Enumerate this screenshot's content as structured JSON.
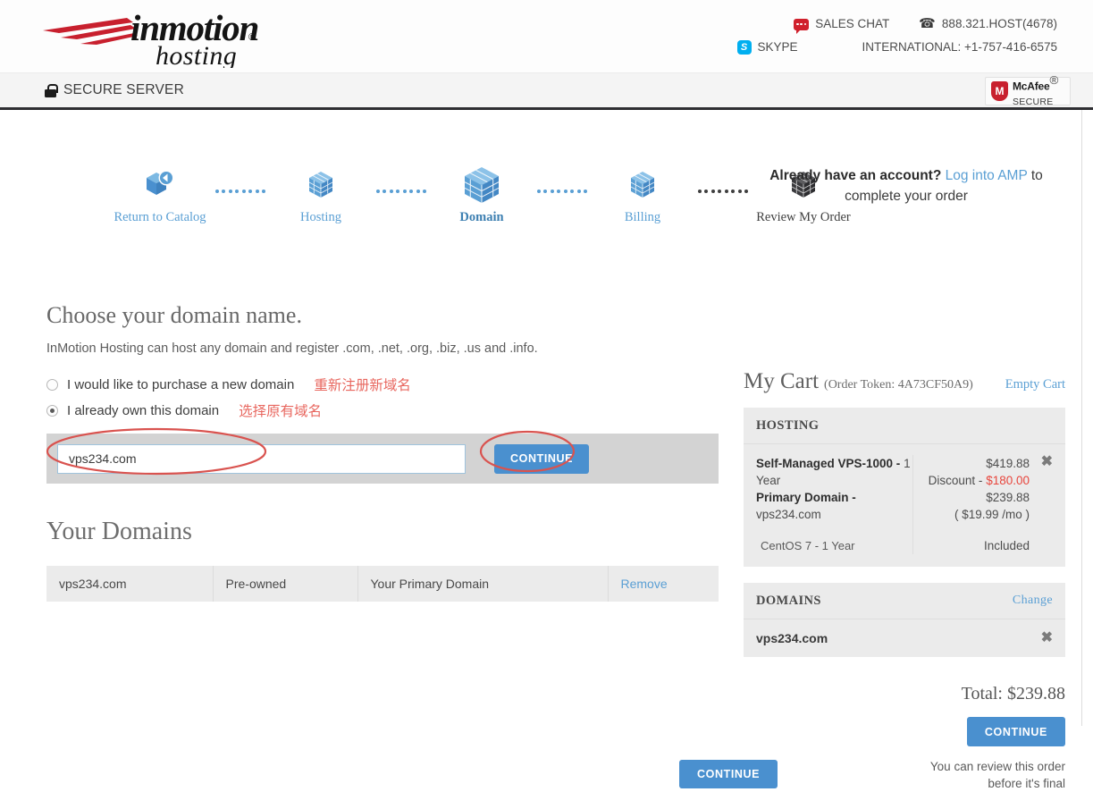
{
  "header": {
    "logo_word": "inmotion",
    "logo_word2": "hosting",
    "logo_reg": "®",
    "contact": {
      "sales_chat": "SALES CHAT",
      "phone": "888.321.HOST(4678)",
      "skype": "SKYPE",
      "international": "INTERNATIONAL: +1-757-416-6575"
    }
  },
  "secure_band": {
    "label": "SECURE SERVER",
    "badge_line1": "McAfee",
    "badge_reg": "®",
    "badge_line2": "SECURE"
  },
  "steps": [
    {
      "label": "Return to Catalog",
      "state": "link"
    },
    {
      "label": "Hosting",
      "state": "link"
    },
    {
      "label": "Domain",
      "state": "active"
    },
    {
      "label": "Billing",
      "state": "link"
    },
    {
      "label": "Review My Order",
      "state": "dark"
    }
  ],
  "account_note": {
    "prefix": "Already have an account?",
    "link": "Log into AMP",
    "middle": "to",
    "suffix": "complete your order"
  },
  "main": {
    "heading": "Choose your domain name.",
    "subheading": "InMotion Hosting can host any domain and register .com, .net, .org, .biz, .us and .info.",
    "options": [
      {
        "label": "I would like to purchase a new domain",
        "selected": false,
        "annotation": "重新注册新域名"
      },
      {
        "label": "I already own this domain",
        "selected": true,
        "annotation": "选择原有域名"
      }
    ],
    "domain_input_value": "vps234.com",
    "domain_input_placeholder": "",
    "search_continue_label": "CONTINUE",
    "your_domains_heading": "Your Domains",
    "domains_table": {
      "rows": [
        {
          "domain": "vps234.com",
          "type": "Pre-owned",
          "role": "Your Primary Domain",
          "action": "Remove"
        }
      ]
    },
    "bottom_continue_label": "CONTINUE"
  },
  "cart": {
    "title": "My Cart",
    "token": "(Order Token: 4A73CF50A9)",
    "empty_cart": "Empty Cart",
    "hosting_header": "HOSTING",
    "item": {
      "name_bold": "Self-Managed VPS-1000 -",
      "name_rest": "1 Year",
      "primary_label": "Primary Domain -",
      "primary_domain": "vps234.com",
      "os": "CentOS 7 - 1 Year",
      "price": "$419.88",
      "discount_label": "Discount -",
      "discount_amount": "$180.00",
      "subtotal": "$239.88",
      "monthly": "( $19.99 /mo )",
      "os_price": "Included",
      "remove_icon": "close-icon"
    },
    "domains_header": "DOMAINS",
    "change_link": "Change",
    "domain_row": {
      "domain": "vps234.com",
      "remove_icon": "close-icon"
    },
    "total": "Total: $239.88",
    "continue_label": "CONTINUE",
    "review_note_line1": "You can review this order",
    "review_note_line2": "before it's final"
  },
  "colors": {
    "accent_blue": "#4a90cf",
    "step_blue": "#5a9fd4",
    "brand_red": "#c8202e",
    "discount_red": "#e8453c",
    "annotation_red": "#e8675f",
    "cart_bg": "#ebebeb"
  }
}
